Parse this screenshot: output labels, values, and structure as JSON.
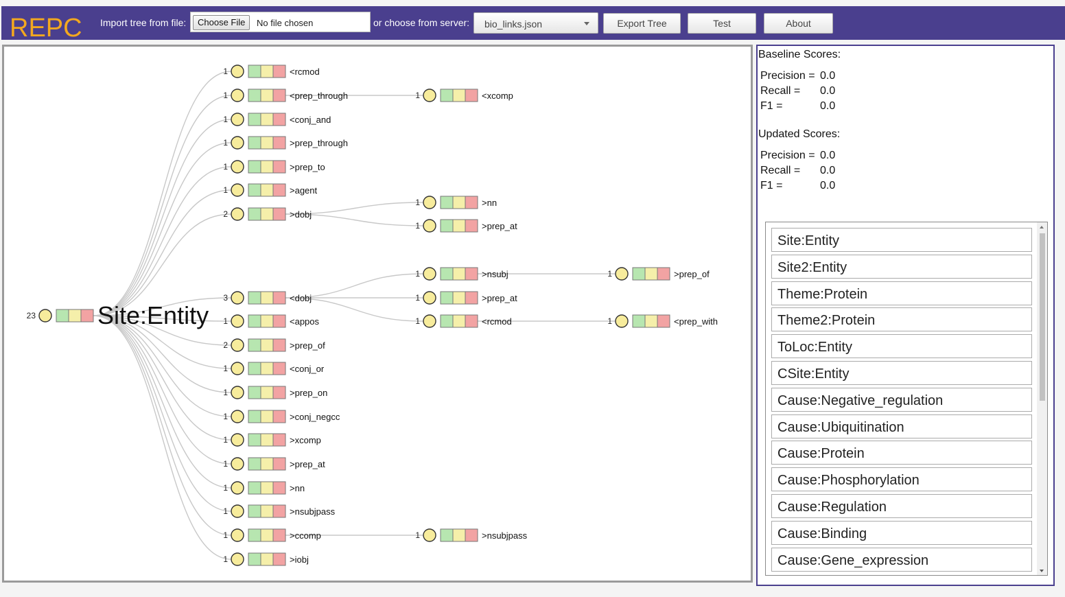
{
  "header": {
    "logo": "REPC",
    "import_label": "Import tree from file:",
    "file_button": "Choose File",
    "file_status": "No file chosen",
    "server_label": "or choose from server:",
    "server_selected": "bio_links.json",
    "export_button": "Export Tree",
    "test_button": "Test",
    "about_button": "About"
  },
  "colors": {
    "header_bg": "#4a3f8e",
    "logo": "#f3a81f",
    "node_fill": "#f7ec9c",
    "box_green": "#b7e6b0",
    "box_yellow": "#f5efaa",
    "box_red": "#f2a3a3"
  },
  "tree": {
    "root": {
      "label": "Site:Entity",
      "count": "23"
    },
    "level1": [
      {
        "label": "<rcmod",
        "count": "1"
      },
      {
        "label": "<prep_through",
        "count": "1"
      },
      {
        "label": "<conj_and",
        "count": "1"
      },
      {
        "label": ">prep_through",
        "count": "1"
      },
      {
        "label": ">prep_to",
        "count": "1"
      },
      {
        "label": ">agent",
        "count": "1"
      },
      {
        "label": ">dobj",
        "count": "2"
      },
      {
        "label": "<dobj",
        "count": "3"
      },
      {
        "label": "<appos",
        "count": "1"
      },
      {
        "label": ">prep_of",
        "count": "2"
      },
      {
        "label": "<conj_or",
        "count": "1"
      },
      {
        "label": ">prep_on",
        "count": "1"
      },
      {
        "label": ">conj_negcc",
        "count": "1"
      },
      {
        "label": ">xcomp",
        "count": "1"
      },
      {
        "label": ">prep_at",
        "count": "1"
      },
      {
        "label": ">nn",
        "count": "1"
      },
      {
        "label": ">nsubjpass",
        "count": "1"
      },
      {
        "label": ">ccomp",
        "count": "1"
      },
      {
        "label": ">iobj",
        "count": "1"
      }
    ],
    "level2": [
      {
        "label": "<xcomp",
        "count": "1",
        "parent": 1
      },
      {
        "label": ">nn",
        "count": "1",
        "parent": 6
      },
      {
        "label": ">prep_at",
        "count": "1",
        "parent": 6
      },
      {
        "label": ">nsubj",
        "count": "1",
        "parent": 7
      },
      {
        "label": ">prep_at",
        "count": "1",
        "parent": 7
      },
      {
        "label": "<rcmod",
        "count": "1",
        "parent": 7
      },
      {
        "label": ">nsubjpass",
        "count": "1",
        "parent": 17
      }
    ],
    "level3": [
      {
        "label": ">prep_of",
        "count": "1",
        "parent": 3
      },
      {
        "label": "<prep_with",
        "count": "1",
        "parent": 5
      }
    ]
  },
  "scores": {
    "baseline_title": "Baseline Scores:",
    "updated_title": "Updated Scores:",
    "baseline": [
      {
        "name": "Precision =",
        "value": "0.0"
      },
      {
        "name": "Recall =",
        "value": "0.0"
      },
      {
        "name": "F1 =",
        "value": "0.0"
      }
    ],
    "updated": [
      {
        "name": "Precision =",
        "value": "0.0"
      },
      {
        "name": "Recall =",
        "value": "0.0"
      },
      {
        "name": "F1 =",
        "value": "0.0"
      }
    ]
  },
  "roles": [
    "Site:Entity",
    "Site2:Entity",
    "Theme:Protein",
    "Theme2:Protein",
    "ToLoc:Entity",
    "CSite:Entity",
    "Cause:Negative_regulation",
    "Cause:Ubiquitination",
    "Cause:Protein",
    "Cause:Phosphorylation",
    "Cause:Regulation",
    "Cause:Binding",
    "Cause:Gene_expression"
  ]
}
